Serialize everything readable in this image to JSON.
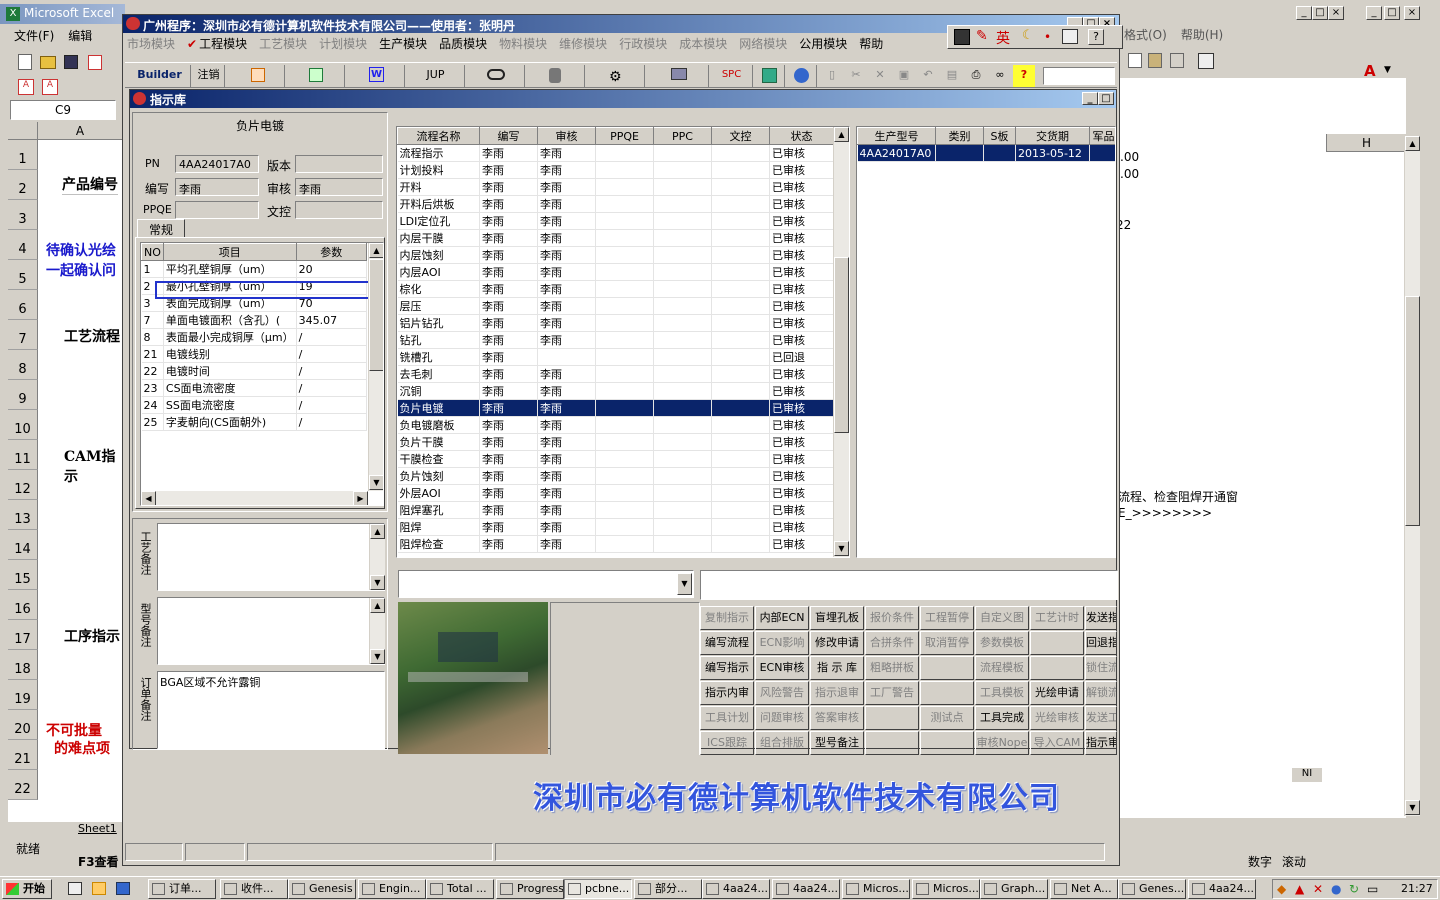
{
  "excel": {
    "title": "Microsoft Excel",
    "menu": [
      "文件(F)",
      "编辑"
    ],
    "namebox": "C9",
    "col_a": "A",
    "col_h": "H",
    "rows": [
      "1",
      "2",
      "3",
      "4",
      "5",
      "6",
      "7",
      "8",
      "9",
      "10",
      "11",
      "12",
      "13",
      "14",
      "15",
      "16",
      "17",
      "18",
      "19",
      "20",
      "21",
      "22"
    ],
    "cells": {
      "r2": "产品编号",
      "r4": "待确认光绘",
      "r4b": "一起确认问",
      "r7": "工艺流程",
      "r11": "CAM指示",
      "r17": "工序指示",
      "r20": "不可批量",
      "r20b": "的难点项"
    },
    "right_vals": [
      ".00",
      ".00",
      "22"
    ],
    "right_text1": "流程、检查阻焊开通窗",
    "right_text2": "E_>>>>>>>>",
    "right_menu": [
      "格式(O)",
      "帮助(H)"
    ],
    "sheet_tab": "Sheet1",
    "status": "就绪",
    "status_right": [
      "数字",
      "滚动"
    ],
    "f3": "F3查看",
    "nl": "NI"
  },
  "app": {
    "title": "广州程序：深圳市必有德计算机软件技术有限公司——使用者：张明丹",
    "menu": [
      "市场模块",
      "工程模块",
      "工艺模块",
      "计划模块",
      "生产模块",
      "品质模块",
      "物料模块",
      "维修模块",
      "行政模块",
      "成本模块",
      "网络模块",
      "公用模块",
      "帮助"
    ],
    "menu_enabled": [
      false,
      true,
      false,
      false,
      true,
      true,
      false,
      false,
      false,
      false,
      false,
      true,
      true
    ],
    "ime": "英",
    "toolbar": {
      "builder": "Builder",
      "logout": "注销",
      "w": "W",
      "jup": "JUP",
      "spc": "SPC"
    }
  },
  "sub": {
    "title": "指示库",
    "header": "负片电镀",
    "pn_label": "PN",
    "pn": "4AA24017A0",
    "ver_label": "版本",
    "ver": "",
    "author_label": "编写",
    "author": "李雨",
    "review_label": "审核",
    "review": "李雨",
    "ppqe_label": "PPQE",
    "ppqe": "",
    "doc_label": "文控",
    "doc": "",
    "tab": "常规",
    "param_cols": [
      "NO",
      "项目",
      "参数"
    ],
    "params": [
      [
        "1",
        "平均孔壁铜厚（um）",
        "20"
      ],
      [
        "2",
        "最小孔壁铜厚（um）",
        "19"
      ],
      [
        "3",
        "表面完成铜厚（um）",
        "70"
      ],
      [
        "7",
        "单面电镀面积（含孔）(",
        "345.07"
      ],
      [
        "8",
        "表面最小完成铜厚（μm）",
        "/"
      ],
      [
        "21",
        "电镀线别",
        "/"
      ],
      [
        "22",
        "电镀时间",
        "/"
      ],
      [
        "23",
        "CS面电流密度",
        "/"
      ],
      [
        "24",
        "SS面电流密度",
        "/"
      ],
      [
        "25",
        "字麦朝向(CS面朝外)",
        "/"
      ]
    ],
    "memo1_label": "工艺备注",
    "memo2_label": "型号备注",
    "memo3_label": "订单备注",
    "memo3": "BGA区域不允许露铜",
    "flow_cols": [
      "流程名称",
      "编写",
      "审核",
      "PPQE",
      "PPC",
      "文控",
      "状态"
    ],
    "flow": [
      [
        "流程指示",
        "李雨",
        "李雨",
        "已审核"
      ],
      [
        "计划投料",
        "李雨",
        "李雨",
        "已审核"
      ],
      [
        "开料",
        "李雨",
        "李雨",
        "已审核"
      ],
      [
        "开料后烘板",
        "李雨",
        "李雨",
        "已审核"
      ],
      [
        "LDI定位孔",
        "李雨",
        "李雨",
        "已审核"
      ],
      [
        "内层干膜",
        "李雨",
        "李雨",
        "已审核"
      ],
      [
        "内层蚀刻",
        "李雨",
        "李雨",
        "已审核"
      ],
      [
        "内层AOI",
        "李雨",
        "李雨",
        "已审核"
      ],
      [
        "棕化",
        "李雨",
        "李雨",
        "已审核"
      ],
      [
        "层压",
        "李雨",
        "李雨",
        "已审核"
      ],
      [
        "铝片钻孔",
        "李雨",
        "李雨",
        "已审核"
      ],
      [
        "钻孔",
        "李雨",
        "李雨",
        "已审核"
      ],
      [
        "铣槽孔",
        "李雨",
        "",
        "已回退"
      ],
      [
        "去毛刺",
        "李雨",
        "李雨",
        "已审核"
      ],
      [
        "沉铜",
        "李雨",
        "李雨",
        "已审核"
      ],
      [
        "负片电镀",
        "李雨",
        "李雨",
        "已审核"
      ],
      [
        "负电镀磨板",
        "李雨",
        "李雨",
        "已审核"
      ],
      [
        "负片干膜",
        "李雨",
        "李雨",
        "已审核"
      ],
      [
        "干膜检查",
        "李雨",
        "李雨",
        "已审核"
      ],
      [
        "负片蚀刻",
        "李雨",
        "李雨",
        "已审核"
      ],
      [
        "外层AOI",
        "李雨",
        "李雨",
        "已审核"
      ],
      [
        "阻焊塞孔",
        "李雨",
        "李雨",
        "已审核"
      ],
      [
        "阻焊",
        "李雨",
        "李雨",
        "已审核"
      ],
      [
        "阻焊检查",
        "李雨",
        "李雨",
        "已审核"
      ]
    ],
    "model_cols": [
      "生产型号",
      "类别",
      "S板",
      "交货期",
      "军品"
    ],
    "model": [
      "4AA24017A0",
      "",
      "",
      "2013-05-12",
      ""
    ],
    "actions": [
      [
        "复制指示",
        "内部ECN",
        "盲埋孔板",
        "报价条件",
        "工程暂停",
        "自定义图",
        "工艺计时",
        "发送指"
      ],
      [
        "编写流程",
        "ECN影响",
        "修改申请",
        "合拼条件",
        "取消暂停",
        "参数模板",
        "",
        "回退指"
      ],
      [
        "编写指示",
        "ECN审核",
        "指 示 库",
        "粗略拼板",
        "",
        "流程模板",
        "",
        "锁住流"
      ],
      [
        "指示内审",
        "风险警告",
        "指示退审",
        "工厂警告",
        "",
        "工具模板",
        "光绘申请",
        "解锁流"
      ],
      [
        "工具计划",
        "问题审核",
        "答案审核",
        "",
        "测试点",
        "工具完成",
        "光绘审核",
        "发送工"
      ],
      [
        "ICS跟踪",
        "组合排版",
        "型号备注",
        "",
        "",
        "审核Nope",
        "导入CAM",
        "指示审"
      ]
    ],
    "actions_enabled": [
      [
        false,
        true,
        true,
        false,
        false,
        false,
        false,
        true
      ],
      [
        true,
        false,
        true,
        false,
        false,
        false,
        false,
        true
      ],
      [
        true,
        true,
        true,
        false,
        false,
        false,
        false,
        false
      ],
      [
        true,
        false,
        false,
        false,
        false,
        false,
        true,
        false
      ],
      [
        false,
        false,
        false,
        false,
        false,
        true,
        false,
        false
      ],
      [
        false,
        false,
        true,
        false,
        false,
        false,
        false,
        true
      ]
    ],
    "brand": "深圳市必有德计算机软件技术有限公司"
  },
  "taskbar": {
    "start": "开始",
    "items": [
      "订单...",
      "收件...",
      "Genesis",
      "Engin...",
      "Total ...",
      "Progress",
      "pcbne...",
      "部分...",
      "4aa24...",
      "4aa24...",
      "Micros...",
      "Micros...",
      "Graph...",
      "Net A...",
      "Genes...",
      "4aa24..."
    ],
    "clock": "21:27"
  },
  "colors": {
    "title_bar": "#0a246a",
    "selection": "#0a246a",
    "brand": "#3355dd",
    "highlight_box": "#2233cc",
    "excel_red": "#cc0000",
    "excel_blue": "#1a1acc"
  }
}
